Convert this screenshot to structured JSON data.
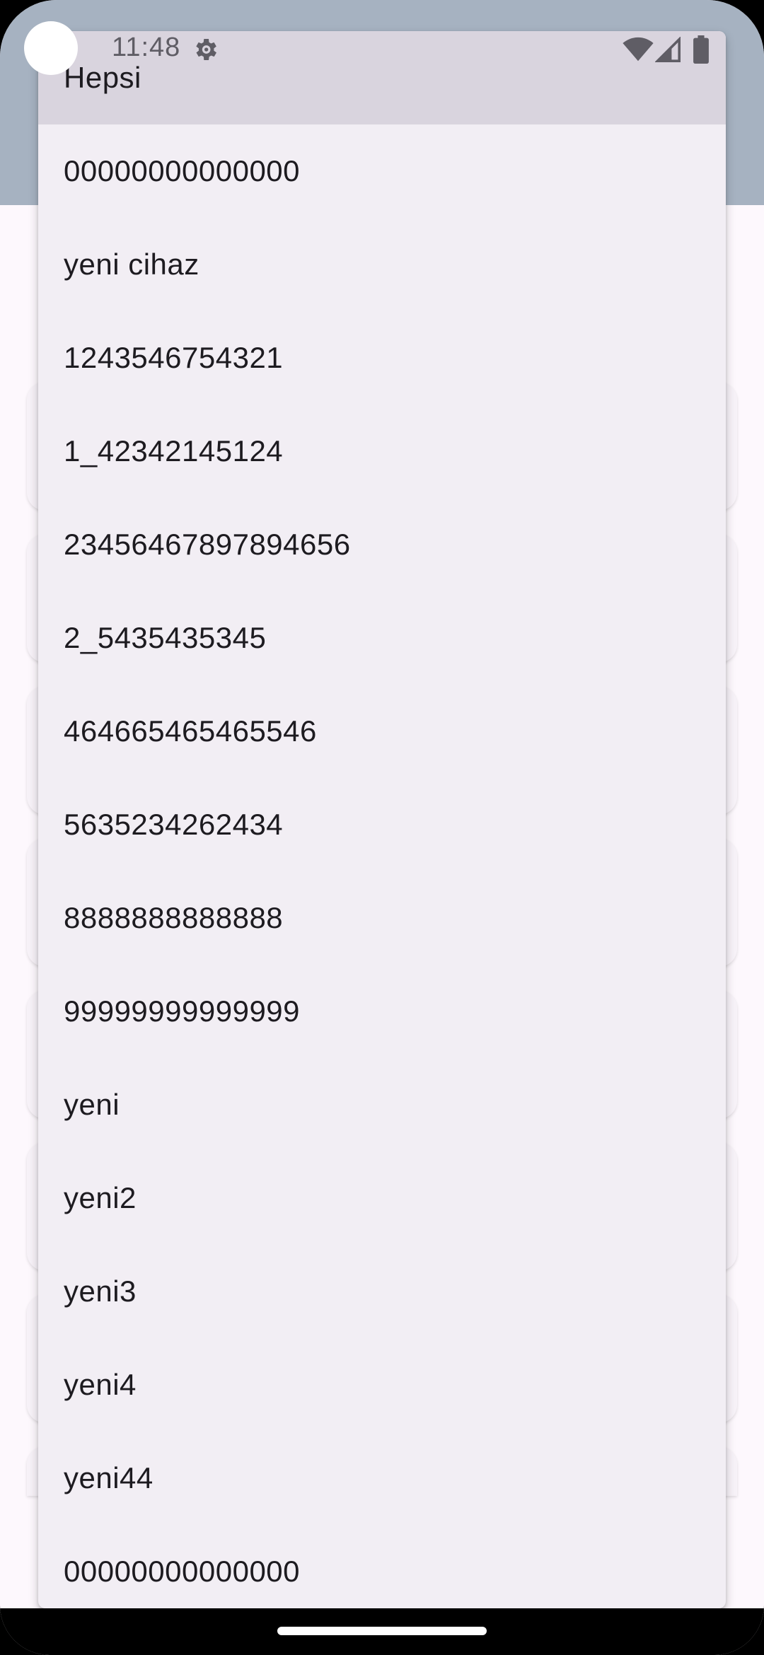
{
  "status_bar": {
    "time": "11:48",
    "icons": [
      "settings-gear-icon",
      "wifi-icon",
      "cellular-signal-icon",
      "battery-icon"
    ]
  },
  "dropdown": {
    "items": [
      {
        "label": "Hepsi",
        "selected": true
      },
      {
        "label": "00000000000000",
        "selected": false
      },
      {
        "label": "yeni cihaz",
        "selected": false
      },
      {
        "label": "1243546754321",
        "selected": false
      },
      {
        "label": "1_42342145124",
        "selected": false
      },
      {
        "label": "23456467897894656",
        "selected": false
      },
      {
        "label": "2_5435435345",
        "selected": false
      },
      {
        "label": "464665465465546",
        "selected": false
      },
      {
        "label": "5635234262434",
        "selected": false
      },
      {
        "label": "8888888888888",
        "selected": false
      },
      {
        "label": "99999999999999",
        "selected": false
      },
      {
        "label": "yeni",
        "selected": false
      },
      {
        "label": "yeni2",
        "selected": false
      },
      {
        "label": "yeni3",
        "selected": false
      },
      {
        "label": "yeni4",
        "selected": false
      },
      {
        "label": "yeni44",
        "selected": false
      },
      {
        "label": "00000000000000",
        "selected": false
      }
    ]
  },
  "colors": {
    "app_bar": "#a6b2c1",
    "menu_background": "#f2eef4",
    "selected_item": "#d9d4de",
    "text": "#1d1b20"
  }
}
